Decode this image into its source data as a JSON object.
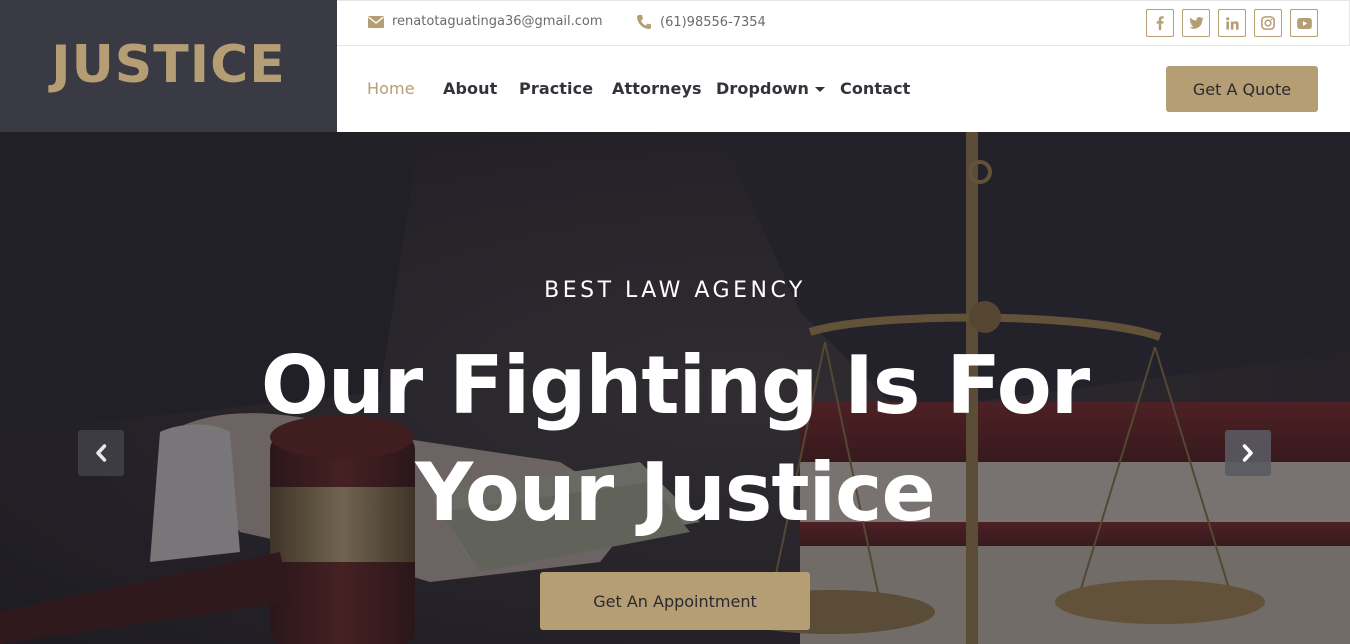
{
  "brand": {
    "name": "JUSTICE"
  },
  "topbar": {
    "email": "renatotaguatinga36@gmail.com",
    "phone": "(61)98556-7354",
    "socials": [
      "facebook-icon",
      "twitter-icon",
      "linkedin-icon",
      "instagram-icon",
      "youtube-icon"
    ]
  },
  "nav": {
    "items": [
      {
        "label": "Home",
        "active": true
      },
      {
        "label": "About"
      },
      {
        "label": "Practice"
      },
      {
        "label": "Attorneys"
      },
      {
        "label": "Dropdown",
        "has_caret": true
      },
      {
        "label": "Contact"
      }
    ],
    "quote_label": "Get A Quote"
  },
  "hero": {
    "kicker": "BEST LAW AGENCY",
    "headline_line1": "Our Fighting Is For",
    "headline_line2": "Your Justice",
    "cta_label": "Get An Appointment"
  },
  "colors": {
    "accent": "#b59e73",
    "brand_bg": "#3a3a44",
    "nav_text": "#33333b"
  }
}
